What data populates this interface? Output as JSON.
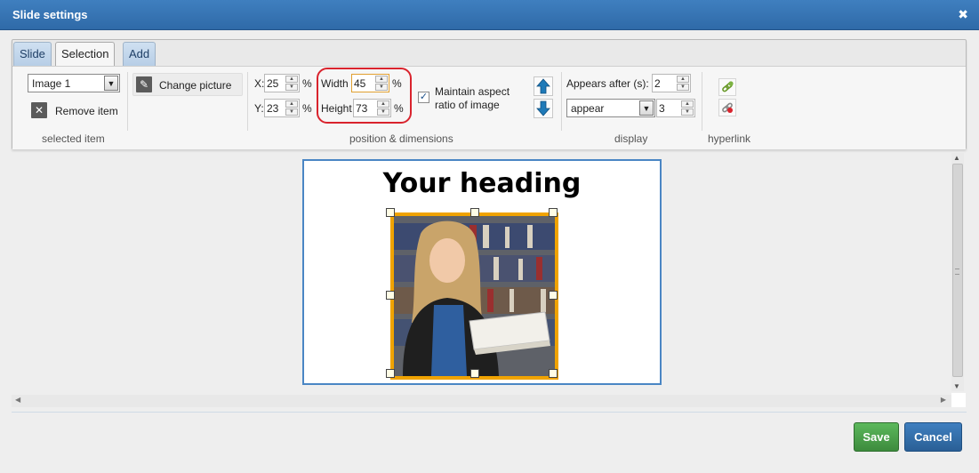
{
  "window": {
    "title": "Slide settings",
    "close_glyph": "✖"
  },
  "tabs": [
    {
      "label": "Slide"
    },
    {
      "label": "Selection"
    },
    {
      "label": "Add"
    }
  ],
  "selected_item": {
    "dropdown_value": "Image 1",
    "remove_label": "Remove item",
    "group_label": "selected item"
  },
  "change_picture": {
    "label": "Change picture"
  },
  "position": {
    "x_label": "X:",
    "x_value": "25",
    "y_label": "Y:",
    "y_value": "23",
    "width_label": "Width",
    "width_value": "45",
    "height_label": "Height",
    "height_value": "73",
    "unit": "%",
    "aspect_label_line1": "Maintain aspect",
    "aspect_label_line2": "ratio of image",
    "aspect_checked": true,
    "group_label": "position & dimensions"
  },
  "display": {
    "appears_label": "Appears after (s):",
    "appears_value": "2",
    "effect_value": "appear",
    "duration_value": "3",
    "group_label": "display"
  },
  "hyperlink": {
    "group_label": "hyperlink"
  },
  "slide": {
    "heading": "Your heading"
  },
  "actions": {
    "save": "Save",
    "cancel": "Cancel"
  },
  "colors": {
    "titlebar": "#3a79b8",
    "selection_border": "#f0a300",
    "highlight": "#d9232d",
    "save": "#4cae4c",
    "cancel": "#3070b0"
  }
}
